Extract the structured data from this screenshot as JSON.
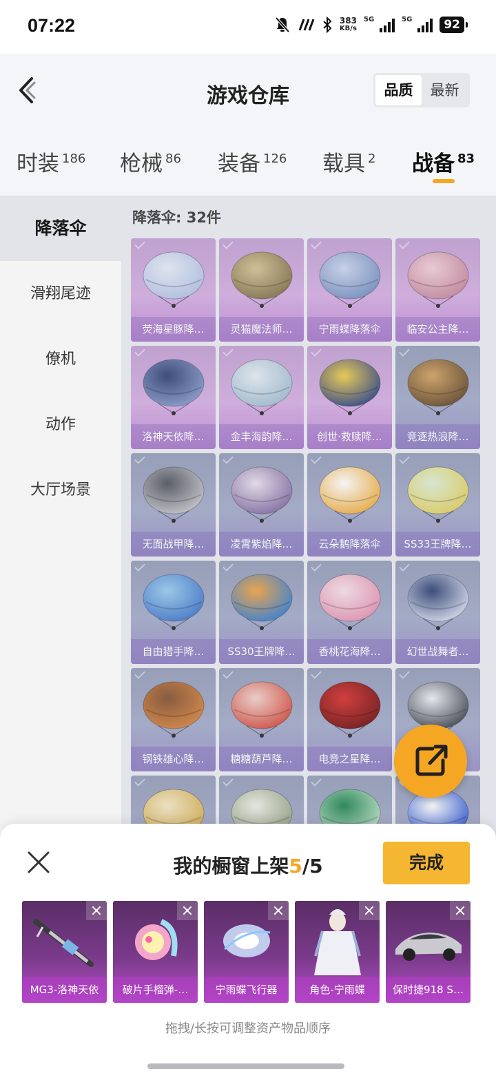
{
  "status_bar": {
    "time": "07:22",
    "speed_value": "383",
    "speed_unit": "KB/s",
    "net1": "5G",
    "net2": "5G",
    "battery": "92"
  },
  "header": {
    "title": "游戏仓库",
    "sort_quality": "品质",
    "sort_latest": "最新"
  },
  "tabs": [
    {
      "label": "时装",
      "count": "186"
    },
    {
      "label": "枪械",
      "count": "86"
    },
    {
      "label": "装备",
      "count": "126"
    },
    {
      "label": "载具",
      "count": "2"
    },
    {
      "label": "战备",
      "count": "83"
    }
  ],
  "sidebar": {
    "items": [
      {
        "label": "降落伞"
      },
      {
        "label": "滑翔尾迹"
      },
      {
        "label": "僚机"
      },
      {
        "label": "动作"
      },
      {
        "label": "大厅场景"
      }
    ]
  },
  "section_title": "降落伞: 32件",
  "items": [
    {
      "label": "荧海星豚降…",
      "tier": "purple"
    },
    {
      "label": "灵猫魔法师…",
      "tier": "purple"
    },
    {
      "label": "宁雨蝶降落伞",
      "tier": "purple"
    },
    {
      "label": "临安公主降…",
      "tier": "purple"
    },
    {
      "label": "洛神天依降…",
      "tier": "purple"
    },
    {
      "label": "金丰海韵降…",
      "tier": "purple"
    },
    {
      "label": "创世·救赎降…",
      "tier": "purple"
    },
    {
      "label": "竞逐热浪降…",
      "tier": "blue"
    },
    {
      "label": "无面战甲降…",
      "tier": "blue"
    },
    {
      "label": "凌霄紫焰降…",
      "tier": "blue"
    },
    {
      "label": "云朵鹅降落伞",
      "tier": "blue"
    },
    {
      "label": "SS33王牌降…",
      "tier": "blue"
    },
    {
      "label": "自由猎手降…",
      "tier": "blue"
    },
    {
      "label": "SS30王牌降…",
      "tier": "blue"
    },
    {
      "label": "香桃花海降…",
      "tier": "blue"
    },
    {
      "label": "幻世战舞者…",
      "tier": "blue"
    },
    {
      "label": "钢铁雄心降…",
      "tier": "blue"
    },
    {
      "label": "糖糖葫芦降…",
      "tier": "blue"
    },
    {
      "label": "电竞之星降…",
      "tier": "blue"
    },
    {
      "label": "",
      "tier": "blue"
    },
    {
      "label": "",
      "tier": "blue"
    },
    {
      "label": "",
      "tier": "blue"
    },
    {
      "label": "",
      "tier": "blue"
    },
    {
      "label": "",
      "tier": "blue"
    }
  ],
  "showcase": {
    "title_prefix": "我的橱窗上架",
    "count_current": "5",
    "count_total": "/5",
    "done_label": "完成",
    "hint": "拖拽/长按可调整资产物品顺序",
    "items": [
      {
        "label": "MG3-洛神天依"
      },
      {
        "label": "破片手榴弹-…"
      },
      {
        "label": "宁雨蝶飞行器"
      },
      {
        "label": "角色-宁雨蝶"
      },
      {
        "label": "保时捷918 S…"
      }
    ]
  },
  "colors": {
    "accent": "#f5a623",
    "purple_tier": "#c6a6d6",
    "blue_tier": "#9aa2bd"
  }
}
